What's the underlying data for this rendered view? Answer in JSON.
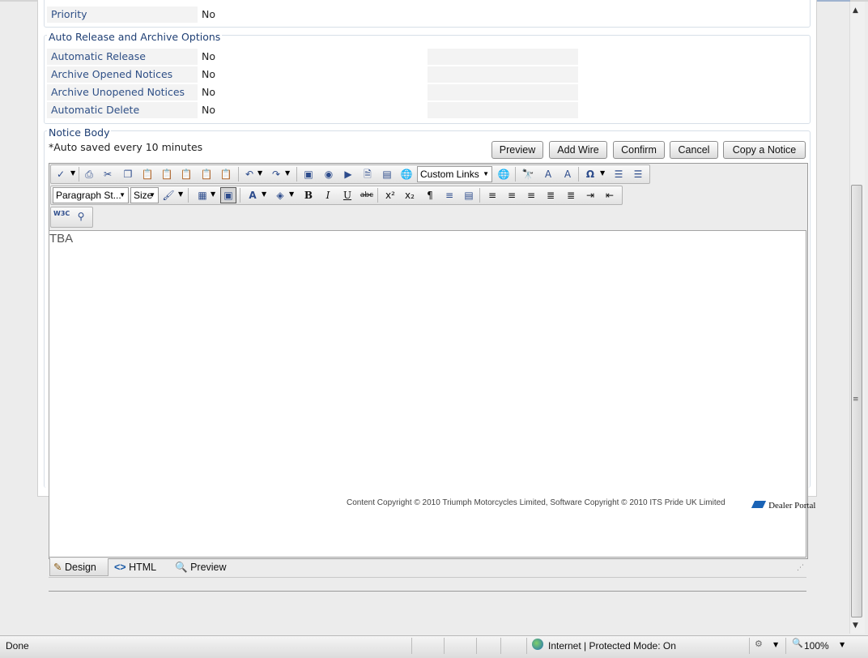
{
  "form": {
    "priority": {
      "label": "Priority",
      "value": "No"
    },
    "auto_release_section": {
      "legend": "Auto Release and Archive Options",
      "rows": [
        {
          "label": "Automatic Release",
          "value": "No"
        },
        {
          "label": "Archive Opened Notices",
          "value": "No"
        },
        {
          "label": "Archive Unopened Notices",
          "value": "No"
        },
        {
          "label": "Automatic Delete",
          "value": "No"
        }
      ]
    },
    "notice_body": {
      "legend": "Notice Body",
      "autosave_note": "*Auto saved every 10 minutes",
      "buttons": {
        "preview": "Preview",
        "add_wire": "Add Wire",
        "confirm": "Confirm",
        "cancel": "Cancel",
        "copy_notice": "Copy a Notice"
      }
    }
  },
  "editor": {
    "toolbar": {
      "custom_links": "Custom Links",
      "paragraph_style": "Paragraph St...",
      "size": "Size",
      "w3c_label": "W3C"
    },
    "content_text": "TBA",
    "tabs": {
      "design": "Design",
      "html": "HTML",
      "preview": "Preview"
    }
  },
  "footer": {
    "copyright": "Content Copyright © 2010 Triumph Motorcycles Limited, Software Copyright © 2010 ITS Pride UK Limited",
    "logo_text": "Dealer Portal"
  },
  "statusbar": {
    "left": "Done",
    "zone": "Internet | Protected Mode: On",
    "zoom": "100%"
  },
  "colors": {
    "label_blue": "#2e4f86",
    "legend_blue": "#1f3f74",
    "page_bg": "#ececec"
  }
}
